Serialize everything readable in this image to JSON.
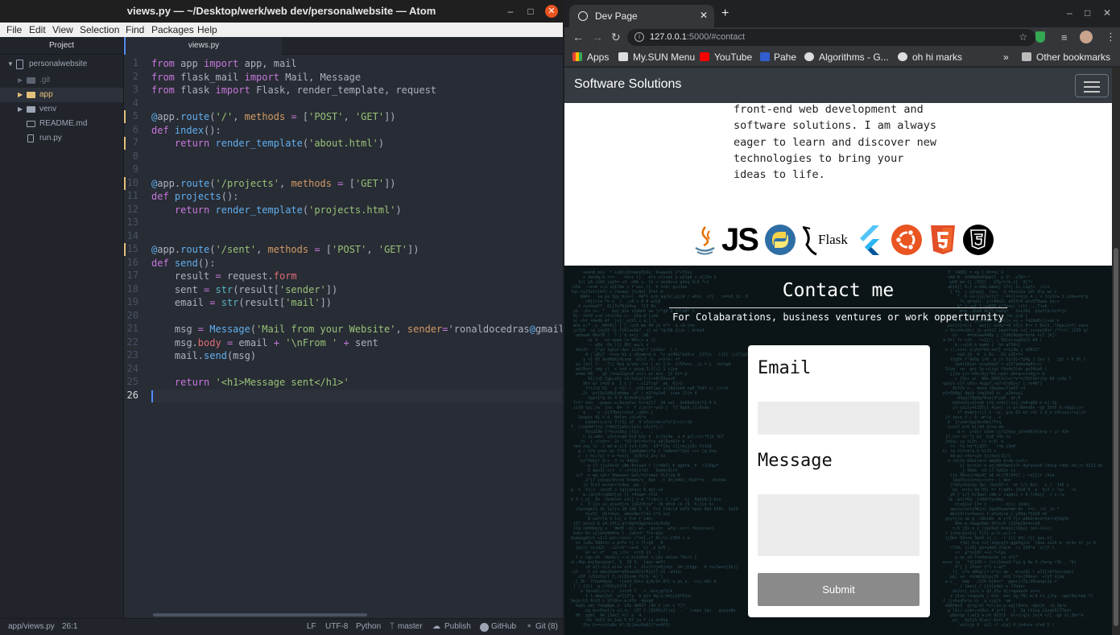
{
  "atom": {
    "title": "views.py — ~/Desktop/werk/web dev/personalwebsite — Atom",
    "menu": [
      "File",
      "Edit",
      "View",
      "Selection",
      "Find",
      "Packages",
      "Help"
    ],
    "tree": {
      "header": "Project",
      "root": "personalwebsite",
      "items": [
        ".git",
        "app",
        "venv",
        "README.md",
        "run.py"
      ]
    },
    "tab": "views.py",
    "line_numbers": [
      "1",
      "2",
      "3",
      "4",
      "5",
      "6",
      "7",
      "8",
      "9",
      "10",
      "11",
      "12",
      "13",
      "14",
      "15",
      "16",
      "17",
      "18",
      "19",
      "20",
      "21",
      "22",
      "23",
      "24",
      "25",
      "26"
    ],
    "code_lines": [
      "from app import app, mail",
      "from flask_mail import Mail, Message",
      "from flask import Flask, render_template, request",
      "",
      "@app.route('/', methods = ['POST', 'GET'])",
      "def index():",
      "    return render_template('about.html')",
      "",
      "",
      "@app.route('/projects', methods = ['GET'])",
      "def projects():",
      "    return render_template('projects.html')",
      "",
      "",
      "@app.route('/sent', methods = ['POST', 'GET'])",
      "def send():",
      "    result = request.form",
      "    sent = str(result['sender'])",
      "    email = str(result['mail'])",
      "",
      "    msg = Message('Mail from your Website', sender='ronaldocedras@gmail.com",
      "    msg.body = email + '\\nFrom ' + sent",
      "    mail.send(msg)",
      "",
      "    return '<h1>Message sent</h1>'",
      ""
    ],
    "status": {
      "file": "app/views.py",
      "cursor": "26:1",
      "line_ending": "LF",
      "encoding": "UTF-8",
      "grammar": "Python",
      "branch": "master",
      "publish": "Publish",
      "github": "GitHub",
      "git": "Git (8)"
    }
  },
  "chrome": {
    "tab_title": "Dev Page",
    "url_host": "127.0.0.1",
    "url_rest": ":5000/#contact",
    "bookmarks": [
      "Apps",
      "My.SUN Menu",
      "YouTube",
      "Pahe",
      "Algorithms - G...",
      "oh hi marks"
    ],
    "bookmarks_overflow": "»",
    "other_bookmarks": "Other bookmarks"
  },
  "site": {
    "brand": "Software Solutions",
    "about_text": "front-end web development and\nsoftware solutions. I am always\neager to learn and discover new\ntechnologies to bring your\nideas to life.",
    "tech_icons": [
      "java-icon",
      "js-icon",
      "python-icon",
      "flask-icon",
      "flutter-icon",
      "ubuntu-icon",
      "html5-icon",
      "css3-icon"
    ],
    "js_label": "JS",
    "flask_label": "Flask",
    "contact_title": "Contact me",
    "contact_subtitle": "For Colabarations, business ventures or work opperturnity",
    "form": {
      "email_label": "Email",
      "email_value": "",
      "message_label": "Message",
      "message_value": "",
      "submit_label": "Submit"
    }
  },
  "colors": {
    "atom_bg": "#282c34",
    "atom_close": "#e95420",
    "navbar": "#343a40",
    "contact_bg": "#0b1518"
  }
}
